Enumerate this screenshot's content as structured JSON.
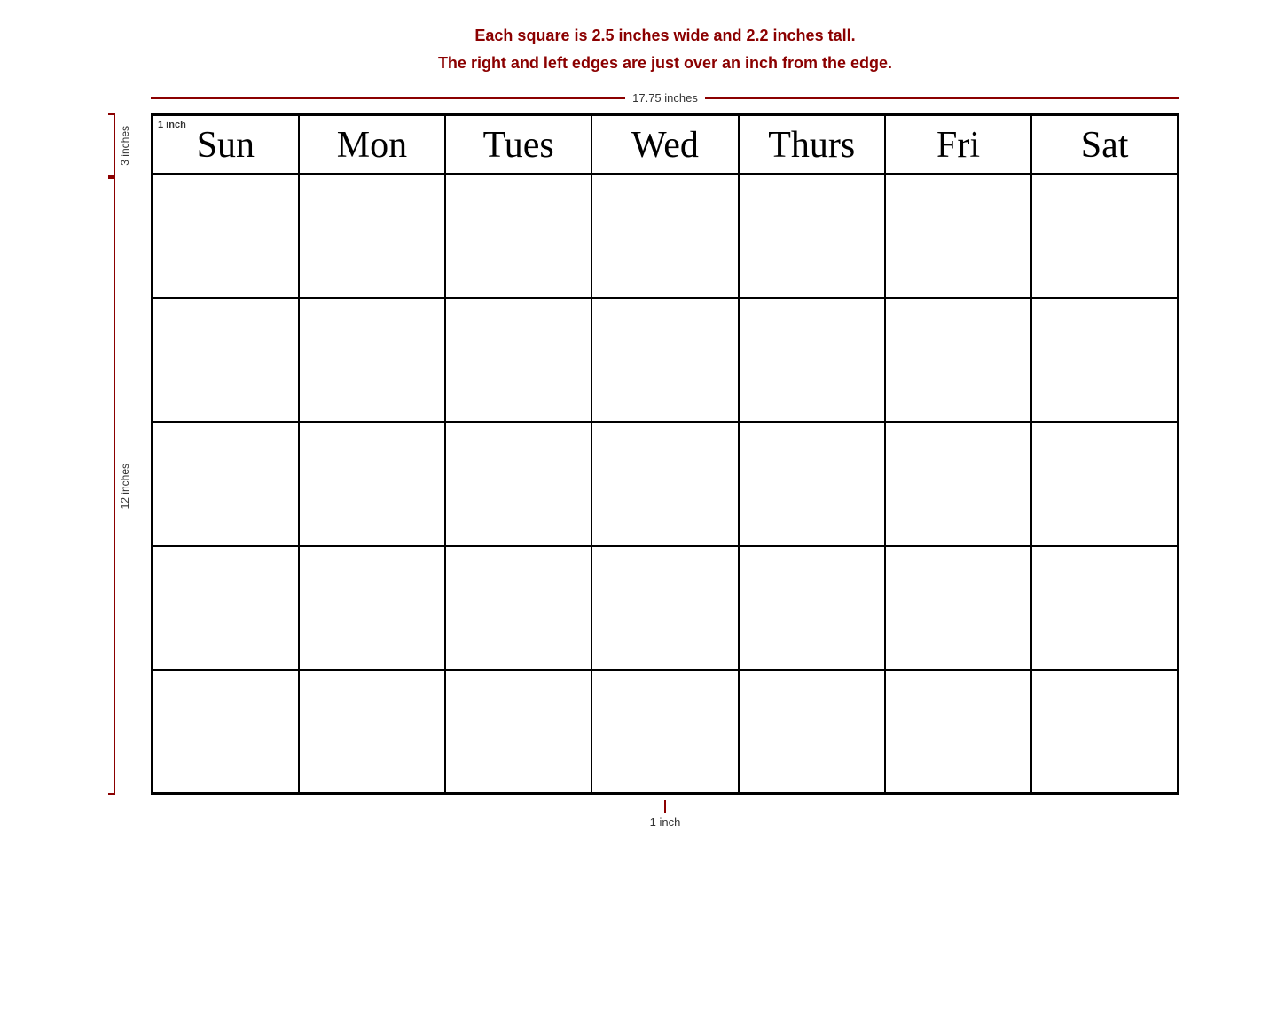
{
  "page": {
    "info_line1": "Each square is 2.5 inches wide and 2.2 inches tall.",
    "info_line2": "The right and left edges are just over an inch from the edge.",
    "width_label": "17.75 inches",
    "height_label_3": "3 inches",
    "height_label_12": "12 inches",
    "bottom_inch_label": "1 inch"
  },
  "calendar": {
    "days": [
      {
        "id": "sun",
        "label": "Sun",
        "has_inch_note": true,
        "inch_note": "1 inch"
      },
      {
        "id": "mon",
        "label": "Mon",
        "has_inch_note": false
      },
      {
        "id": "tue",
        "label": "Tues",
        "has_inch_note": false
      },
      {
        "id": "wed",
        "label": "Wed",
        "has_inch_note": false
      },
      {
        "id": "thu",
        "label": "Thurs",
        "has_inch_note": false
      },
      {
        "id": "fri",
        "label": "Fri",
        "has_inch_note": false
      },
      {
        "id": "sat",
        "label": "Sat",
        "has_inch_note": false
      }
    ],
    "row_count": 5
  }
}
